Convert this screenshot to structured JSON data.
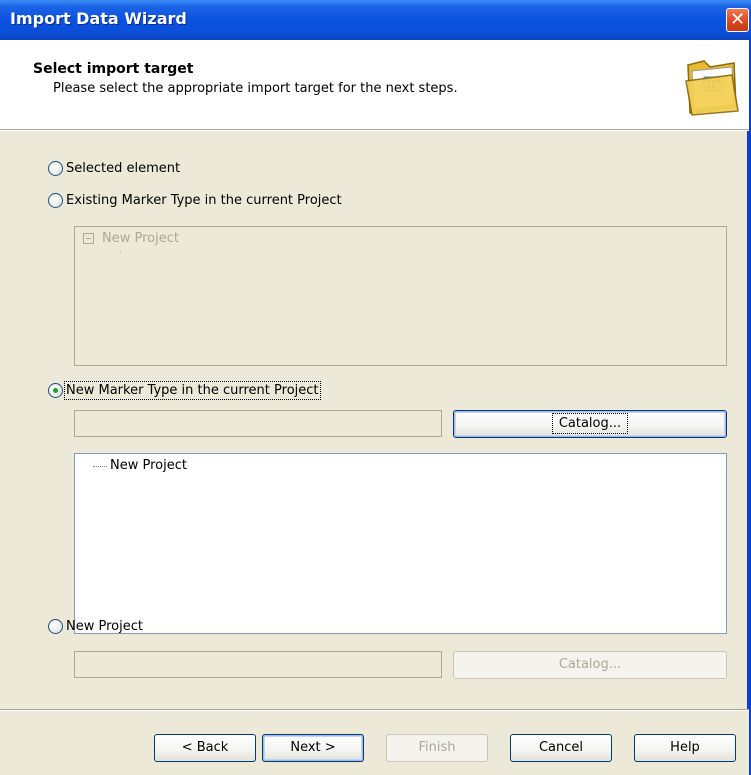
{
  "window": {
    "title": "Import Data Wizard",
    "close_label": "✕"
  },
  "header": {
    "title": "Select import target",
    "subtitle": "Please select the appropriate import target for the next steps.",
    "icon": "folder-icon"
  },
  "options": {
    "selected_element": {
      "label": "Selected element",
      "checked": false
    },
    "existing_marker": {
      "label": "Existing Marker Type in the current Project",
      "checked": false
    },
    "new_marker": {
      "label": "New Marker Type in the current Project",
      "checked": true
    },
    "new_project": {
      "label": "New Project",
      "checked": false
    }
  },
  "existing_tree": {
    "root": "New Project",
    "enabled": false
  },
  "new_marker_section": {
    "name_value": "",
    "catalog_label": "Catalog...",
    "tree_root": "New Project"
  },
  "new_project_section": {
    "name_value": "",
    "catalog_label": "Catalog..."
  },
  "footer": {
    "back": "< Back",
    "next": "Next >",
    "finish": "Finish",
    "cancel": "Cancel",
    "help": "Help"
  },
  "colors": {
    "titlebar": "#0a52df",
    "dialog_bg": "#ece9d8",
    "radio_check": "#21a121",
    "close_button": "#d9441c"
  }
}
